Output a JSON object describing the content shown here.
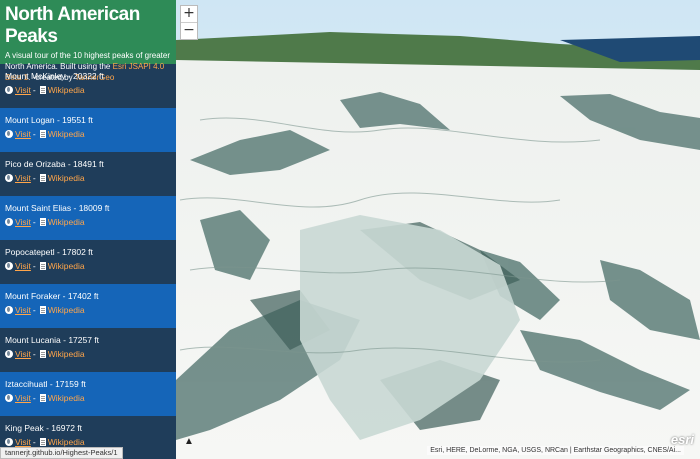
{
  "sidebar": {
    "title": "North American Peaks",
    "desc_prefix": "A visual tour of the 10 highest peaks of greater North America. Built using the ",
    "desc_link": "Esri JSAPI 4.0 Beta 1",
    "desc_suffix": ". -created by ",
    "author": "TannerGeo",
    "peaks": [
      {
        "name": "Mount McKinley - 20322 ft",
        "visit": "Visit",
        "wiki": "Wikipedia"
      },
      {
        "name": "Mount Logan - 19551 ft",
        "visit": "Visit",
        "wiki": "Wikipedia"
      },
      {
        "name": "Pico de Orizaba - 18491 ft",
        "visit": "Visit",
        "wiki": "Wikipedia"
      },
      {
        "name": "Mount Saint Elias - 18009 ft",
        "visit": "Visit",
        "wiki": "Wikipedia"
      },
      {
        "name": "Popocatepetl - 17802 ft",
        "visit": "Visit",
        "wiki": "Wikipedia"
      },
      {
        "name": "Mount Foraker - 17402 ft",
        "visit": "Visit",
        "wiki": "Wikipedia"
      },
      {
        "name": "Mount Lucania - 17257 ft",
        "visit": "Visit",
        "wiki": "Wikipedia"
      },
      {
        "name": "Iztaccihuatl - 17159 ft",
        "visit": "Visit",
        "wiki": "Wikipedia"
      },
      {
        "name": "King Peak - 16972 ft",
        "visit": "Visit",
        "wiki": "Wikipedia"
      }
    ]
  },
  "map": {
    "zoom_in": "+",
    "zoom_out": "−",
    "attribution": "Esri, HERE, DeLorme, NGA, USGS, NRCan | Earthstar Geographics, CNES/Ai...",
    "logo": "esri",
    "status_url": "tannerjt.github.io/Highest-Peaks/1"
  },
  "colors": {
    "header": "#2e8b57",
    "row_dark": "#1f3d5a",
    "row_blue": "#1565b8",
    "link": "#ffa54a"
  }
}
